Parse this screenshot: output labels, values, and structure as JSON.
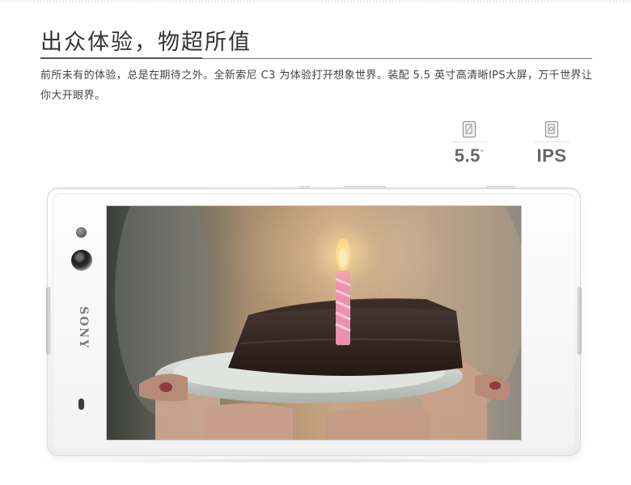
{
  "heading": {
    "title": "出众体验，物超所值",
    "description": "前所未有的体验，总是在期待之外。全新索尼 C3 为体验打开想象世界。装配 5.5 英寸高清晰IPS大屏，万千世界让你大开眼界。"
  },
  "specs": [
    {
      "icon": "screen-size-icon",
      "value": "5.5",
      "unit": "\""
    },
    {
      "icon": "ips-panel-icon",
      "value": "IPS",
      "unit": ""
    }
  ],
  "phone": {
    "brand": "SONY",
    "screen_image": "birthday-cake-candle-photo"
  }
}
